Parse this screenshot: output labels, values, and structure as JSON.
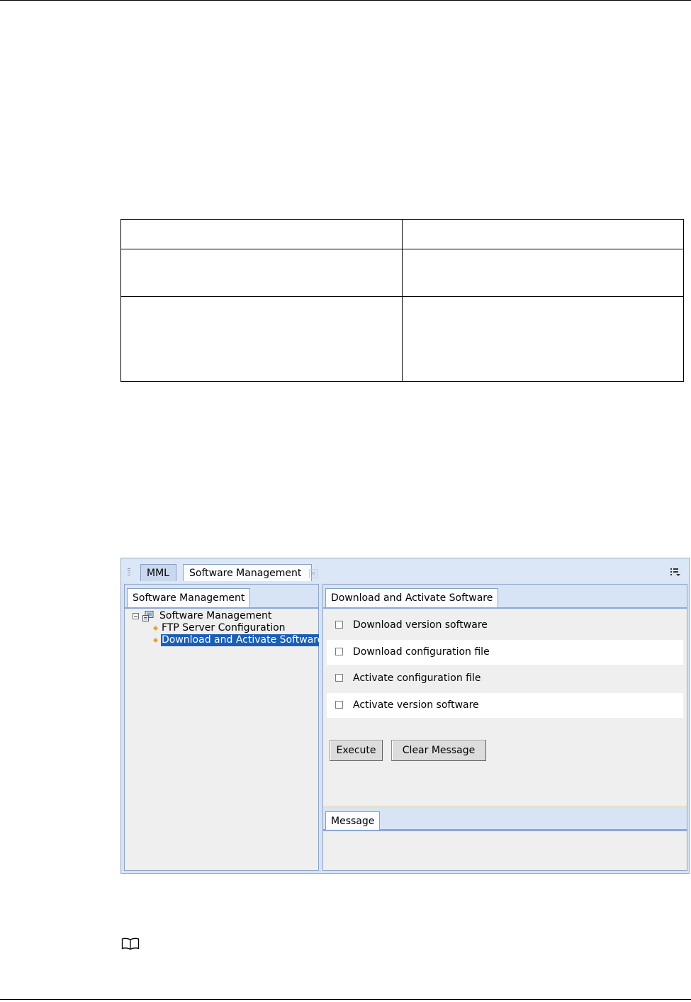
{
  "window": {
    "tabs": [
      {
        "label": "MML"
      },
      {
        "label": "Software Management"
      }
    ],
    "close_glyph": "×",
    "menu_icon": "list-menu-icon"
  },
  "left_panel": {
    "tab_label": "Software Management",
    "tree": {
      "root": "Software Management",
      "children": [
        {
          "label": "FTP Server Configuration"
        },
        {
          "label": "Download and Activate Software",
          "selected": true
        }
      ]
    }
  },
  "right_panel": {
    "tab_label": "Download and Activate Software",
    "options": [
      {
        "label": "Download version software",
        "checked": false
      },
      {
        "label": "Download configuration file",
        "checked": false
      },
      {
        "label": "Activate configuration file",
        "checked": false
      },
      {
        "label": "Activate version software",
        "checked": false
      }
    ],
    "buttons": {
      "execute": "Execute",
      "clear": "Clear Message"
    },
    "message": {
      "tab_label": "Message"
    }
  },
  "document": {
    "note_icon": "book-note-icon"
  },
  "colors": {
    "selection": "#1a5fb4",
    "tab_strip": "#d7e4f6",
    "panel_bg": "#efefef",
    "leaf_bullet": "#f0a020"
  }
}
